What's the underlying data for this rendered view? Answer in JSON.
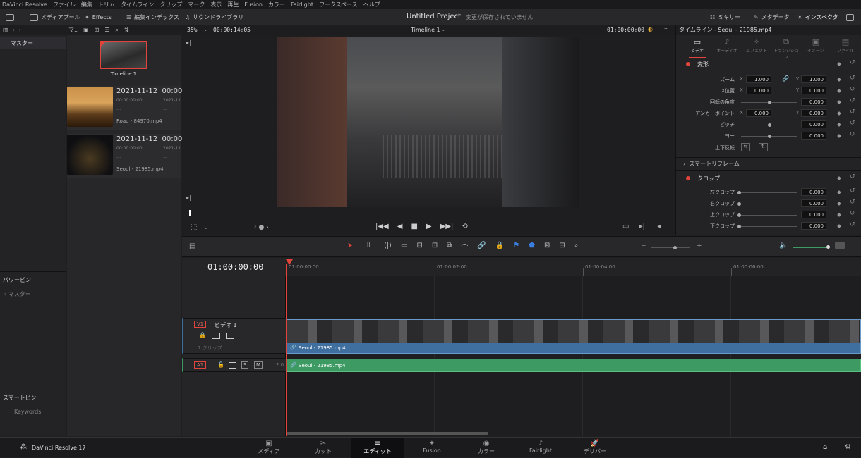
{
  "menu": [
    "DaVinci Resolve",
    "ファイル",
    "編集",
    "トリム",
    "タイムライン",
    "クリップ",
    "マーク",
    "表示",
    "再生",
    "Fusion",
    "カラー",
    "Fairlight",
    "ワークスペース",
    "ヘルプ"
  ],
  "toolbar": {
    "media_pool": "メディアプール",
    "effects": "Effects",
    "edit_index": "編集インデックス",
    "sound_library": "サウンドライブラリ",
    "project_title": "Untitled Project",
    "unsaved": "変更が保存されていません",
    "mixer": "ミキサー",
    "metadata": "メタデータ",
    "inspector": "インスペクタ"
  },
  "pool": {
    "header_label": "マ..",
    "bin_master": "マスター",
    "power_bin": "パワービン",
    "power_master": "マスター",
    "smart_bin": "スマートビン",
    "keywords": "Keywords",
    "timeline_thumb_label": "Timeline 1",
    "clips": [
      {
        "date": "2021-11-12",
        "time": "00:00",
        "tc1": "00:00:00:00",
        "tc2": "2021-11",
        "d1": "---",
        "d2": "---",
        "name": "Road - 84970.mp4"
      },
      {
        "date": "2021-11-12",
        "time": "00:00",
        "tc1": "00:00:00:00",
        "tc2": "2021-11",
        "d1": "---",
        "d2": "---",
        "name": "Seoul - 21985.mp4"
      }
    ]
  },
  "viewer": {
    "zoom": "35%",
    "duration": "00:00:14:05",
    "timeline_name": "Timeline 1",
    "timecode": "01:00:00:00"
  },
  "inspector": {
    "header": "タイムライン - Seoul - 21985.mp4",
    "tabs": [
      "ビデオ",
      "オーディオ",
      "エフェクト",
      "トランジション",
      "イメージ",
      "ファイル"
    ],
    "transform_title": "変形",
    "zoom_label": "ズーム",
    "zoom_x": "1.000",
    "zoom_y": "1.000",
    "position_label": "X位置",
    "position_x": "0.000",
    "position_y": "0.000",
    "rotation_label": "回転の角度",
    "rotation": "0.000",
    "anchor_label": "アンカーポイント",
    "anchor_x": "0.000",
    "anchor_y": "0.000",
    "pitch_label": "ピッチ",
    "pitch": "0.000",
    "yaw_label": "ヨー",
    "yaw": "0.000",
    "flip_label": "上下反転",
    "smart_reframe": "スマートリフレーム",
    "crop_title": "クロップ",
    "crop_left_label": "左クロップ",
    "crop_left": "0.000",
    "crop_right_label": "右クロップ",
    "crop_right": "0.000",
    "crop_top_label": "上クロップ",
    "crop_top": "0.000",
    "crop_bottom_label": "下クロップ",
    "crop_bottom": "0.000",
    "x": "X",
    "y": "Y"
  },
  "timeline": {
    "timecode": "01:00:00:00",
    "ruler": [
      "01:00:00:00",
      "01:00:02:00",
      "01:00:04:00",
      "01:00:06:00"
    ],
    "v1_badge": "V1",
    "v1_name": "ビデオ 1",
    "v1_clips": "1 クリップ",
    "a1_badge": "A1",
    "a1_level": "2.0",
    "solo": "S",
    "mute": "M",
    "video_clip_name": "Seoul - 21985.mp4",
    "audio_clip_name": "Seoul - 21985.mp4"
  },
  "pages": {
    "app_name": "DaVinci Resolve 17",
    "items": [
      "メディア",
      "カット",
      "エディット",
      "Fusion",
      "カラー",
      "Fairlight",
      "デリバー"
    ]
  },
  "colors": {
    "accent": "#e0443a",
    "video_clip": "#3f6f9f",
    "audio_clip": "#3d9a62",
    "playhead": "#e0443a"
  }
}
